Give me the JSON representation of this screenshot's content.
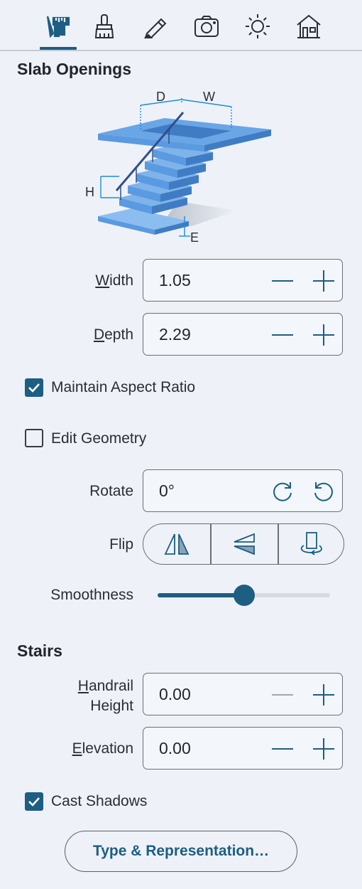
{
  "toolbar": {
    "tabs": [
      {
        "name": "measure-tools-icon",
        "active": true
      },
      {
        "name": "brush-icon",
        "active": false
      },
      {
        "name": "pencil-icon",
        "active": false
      },
      {
        "name": "camera-icon",
        "active": false
      },
      {
        "name": "sun-icon",
        "active": false
      },
      {
        "name": "house-icon",
        "active": false
      }
    ]
  },
  "slab": {
    "title": "Slab Openings",
    "diagram_labels": {
      "d": "D",
      "w": "W",
      "h": "H",
      "e": "E"
    },
    "width": {
      "label_u": "W",
      "label_rest": "idth",
      "value": "1.05"
    },
    "depth": {
      "label_u": "D",
      "label_rest": "epth",
      "value": "2.29"
    },
    "maintain_aspect": {
      "label": "Maintain Aspect Ratio",
      "checked": true
    },
    "edit_geometry": {
      "label": "Edit Geometry",
      "checked": false
    },
    "rotate": {
      "label": "Rotate",
      "value": "0°"
    },
    "flip": {
      "label": "Flip"
    },
    "smoothness": {
      "label": "Smoothness",
      "value": 0.5
    }
  },
  "stairs": {
    "title": "Stairs",
    "handrail": {
      "label_u": "H",
      "label_rest": "andrail",
      "label_line2": "Height",
      "value": "0.00"
    },
    "elevation": {
      "label_u": "E",
      "label_rest": "levation",
      "value": "0.00"
    },
    "cast_shadows": {
      "label": "Cast Shadows",
      "checked": true
    }
  },
  "footer": {
    "button_label": "Type & Representation…"
  },
  "colors": {
    "accent": "#1d5e82",
    "background": "#eef2f8",
    "stair_blue": "#5a9ae0"
  }
}
